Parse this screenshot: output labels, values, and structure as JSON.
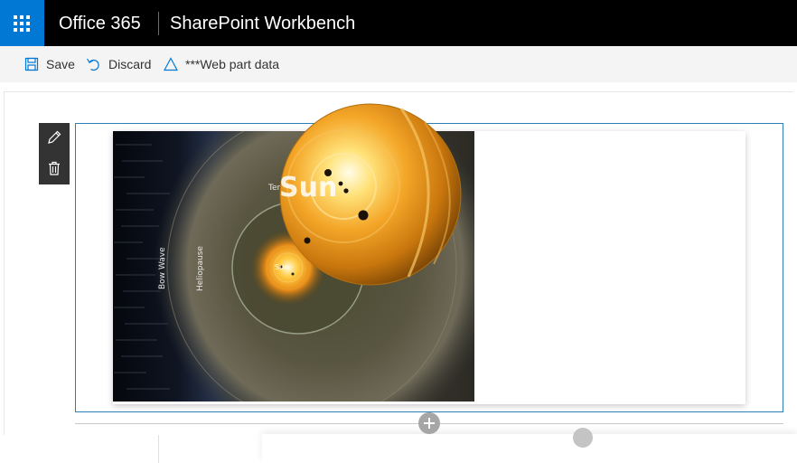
{
  "topbar": {
    "brand": "Office 365",
    "app_title": "SharePoint Workbench",
    "accent_color": "#0078d4",
    "waffle_icon": "waffle-icon"
  },
  "commands": [
    {
      "label": "Save",
      "icon": "save-icon"
    },
    {
      "label": "Discard",
      "icon": "discard-icon"
    },
    {
      "label": "***Web part data",
      "icon": "triangle-icon"
    }
  ],
  "webpart_toolbar": {
    "edit_icon": "pencil-icon",
    "delete_icon": "trash-icon"
  },
  "image": {
    "label_bow_wave": "Bow Wave",
    "label_heliopause": "Heliopause",
    "label_termination": "Termination Shock",
    "label_sun_small": "Sun",
    "label_sun_large": "Sun"
  },
  "canvas": {
    "add_icon": "plus-circle-icon"
  }
}
